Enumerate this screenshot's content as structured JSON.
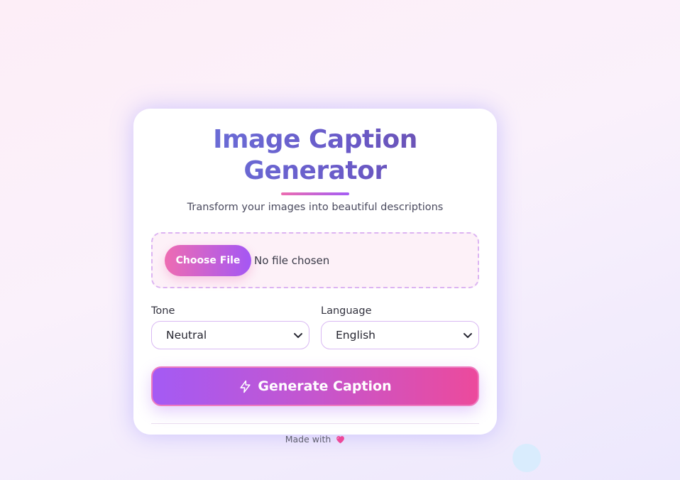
{
  "card": {
    "title": "Image Caption Generator",
    "subtitle": "Transform your images into beautiful descriptions"
  },
  "upload": {
    "button_label": "Choose File",
    "status": "No file chosen"
  },
  "tone": {
    "label": "Tone",
    "selected": "Neutral"
  },
  "language": {
    "label": "Language",
    "selected": "English"
  },
  "generate": {
    "label": "Generate Caption",
    "icon": "lightning-bolt-icon"
  },
  "footer": {
    "text": "Made with",
    "icon": "heart-icon"
  },
  "colors": {
    "accent_pink": "#ec4a9c",
    "accent_purple": "#a45af4",
    "title_blue": "#6b74dc",
    "heart": "#ec4899"
  }
}
